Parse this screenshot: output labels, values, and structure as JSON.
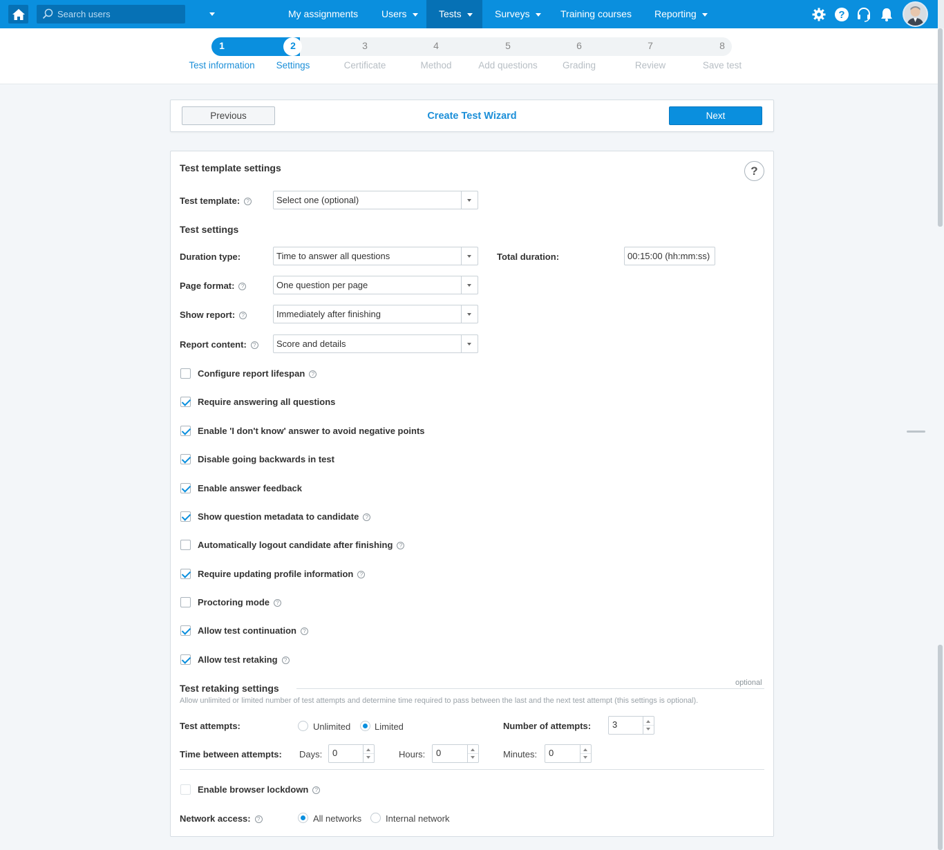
{
  "topbar": {
    "search_placeholder": "Search users",
    "nav": [
      {
        "label": "My assignments"
      },
      {
        "label": "Users"
      },
      {
        "label": "Tests"
      },
      {
        "label": "Surveys"
      },
      {
        "label": "Training courses"
      },
      {
        "label": "Reporting"
      }
    ],
    "icons": [
      "home-icon",
      "search-icon",
      "gear-icon",
      "help-icon",
      "headset-icon",
      "bell-icon",
      "avatar"
    ],
    "accent_color": "#0a8fde"
  },
  "steps": [
    {
      "num": "1",
      "label": "Test information"
    },
    {
      "num": "2",
      "label": "Settings"
    },
    {
      "num": "3",
      "label": "Certificate"
    },
    {
      "num": "4",
      "label": "Method"
    },
    {
      "num": "5",
      "label": "Add questions"
    },
    {
      "num": "6",
      "label": "Grading"
    },
    {
      "num": "7",
      "label": "Review"
    },
    {
      "num": "8",
      "label": "Save test"
    }
  ],
  "wizard": {
    "previous_label": "Previous",
    "title": "Create Test Wizard",
    "next_label": "Next"
  },
  "template_section": {
    "title": "Test template settings",
    "help": "?",
    "template_label": "Test template:",
    "template_value": "Select one (optional)"
  },
  "settings": {
    "title": "Test settings",
    "duration_type_label": "Duration type:",
    "duration_type_value": "Time to answer all questions",
    "total_duration_label": "Total duration:",
    "total_duration_value": "00:15:00 (hh:mm:ss)",
    "page_format_label": "Page format:",
    "page_format_value": "One question per page",
    "show_report_label": "Show report:",
    "show_report_value": "Immediately after finishing",
    "report_content_label": "Report content:",
    "report_content_value": "Score and details",
    "checkboxes": [
      {
        "label": "Configure report lifespan",
        "checked": false
      },
      {
        "label": "Require answering all questions",
        "checked": true
      },
      {
        "label": "Enable 'I don't know' answer to avoid negative points",
        "checked": true
      },
      {
        "label": "Disable going backwards in test",
        "checked": true
      },
      {
        "label": "Enable answer feedback",
        "checked": true
      },
      {
        "label": "Show question metadata to candidate",
        "checked": true
      },
      {
        "label": "Automatically logout candidate after finishing",
        "checked": false
      },
      {
        "label": "Require updating profile information",
        "checked": true
      },
      {
        "label": "Proctoring mode",
        "checked": false
      },
      {
        "label": "Allow test continuation",
        "checked": true
      },
      {
        "label": "Allow test retaking",
        "checked": true
      }
    ]
  },
  "retaking": {
    "title": "Test retaking settings",
    "optional": "optional",
    "description": "Allow unlimited or limited number of test attempts and determine time required to pass between the last and the next test attempt (this settings is optional).",
    "attempts_label": "Test attempts:",
    "unlimited_label": "Unlimited",
    "limited_label": "Limited",
    "number_label": "Number of attempts:",
    "number_value": "3",
    "time_label": "Time between attempts:",
    "days_label": "Days:",
    "days_value": "0",
    "hours_label": "Hours:",
    "hours_value": "0",
    "minutes_label": "Minutes:",
    "minutes_value": "0"
  },
  "lockdown": {
    "label": "Enable browser lockdown",
    "network_label": "Network access:",
    "all_networks": "All networks",
    "internal_network": "Internal network"
  }
}
